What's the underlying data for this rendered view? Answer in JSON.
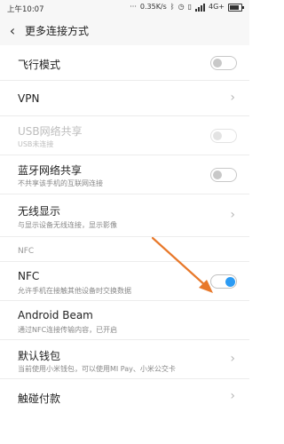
{
  "status_bar": {
    "time": "上午10:07",
    "network_speed": "0.35K/s",
    "network_type": "4G+",
    "icons": [
      "bluetooth-icon",
      "alarm-icon",
      "vibrate-icon",
      "signal-icon",
      "battery-icon"
    ],
    "battery_level": 0.8
  },
  "header": {
    "title": "更多连接方式",
    "back_icon": "back-icon"
  },
  "settings": [
    {
      "label": "飞行模式",
      "control": "toggle",
      "state": "off"
    },
    {
      "label": "VPN",
      "control": "chevron"
    },
    {
      "label": "USB网络共享",
      "sub": "USB未连接",
      "control": "toggle",
      "state": "off",
      "disabled": true
    },
    {
      "label": "蓝牙网络共享",
      "sub": "不共享该手机的互联网连接",
      "control": "toggle",
      "state": "off"
    },
    {
      "label": "无线显示",
      "sub": "与显示设备无线连接，显示影像",
      "control": "chevron"
    }
  ],
  "nfc_section": {
    "title": "NFC",
    "items": [
      {
        "label": "NFC",
        "sub": "允许手机在接触其他设备时交换数据",
        "control": "toggle",
        "state": "on"
      },
      {
        "label": "Android Beam",
        "sub": "通过NFC连接传输内容，已开启",
        "control": "none"
      },
      {
        "label": "默认钱包",
        "sub": "当前使用小米钱包，可以使用MI Pay、小米公交卡",
        "control": "chevron"
      },
      {
        "label": "触碰付款",
        "control": "chevron"
      }
    ]
  },
  "colors": {
    "accent": "#2b9bf4",
    "annotation_arrow": "#e8792b",
    "background": "#ffffff",
    "header_bg": "#f7f7f7"
  }
}
